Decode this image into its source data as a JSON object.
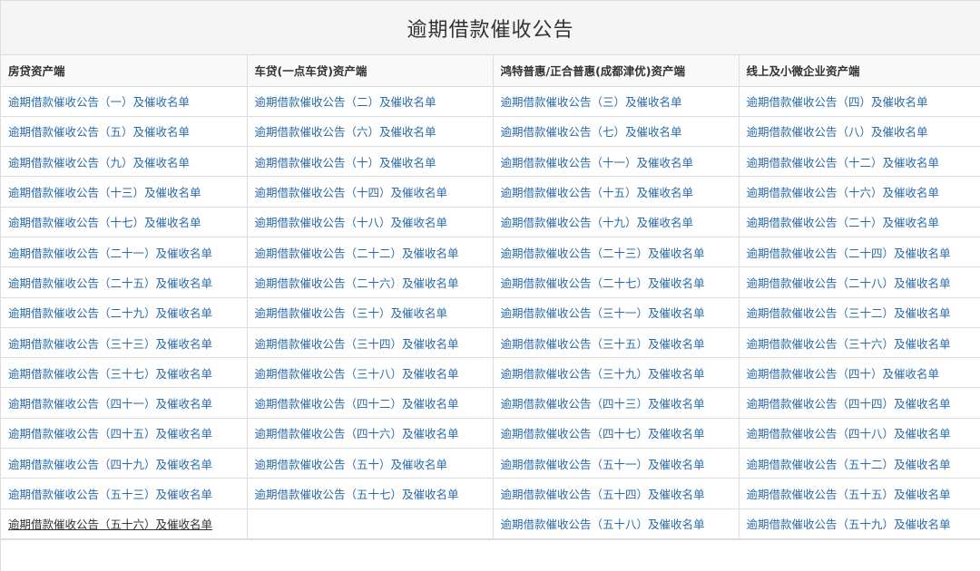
{
  "page": {
    "title": "逾期借款催收公告"
  },
  "table": {
    "headers": [
      "房贷资产端",
      "车贷(一点车贷)资产端",
      "鸿特普惠/正合普惠(成都津优)资产端",
      "线上及小微企业资产端"
    ],
    "rows": [
      [
        "逾期借款催收公告（一）及催收名单",
        "逾期借款催收公告（二）及催收名单",
        "逾期借款催收公告（三）及催收名单",
        "逾期借款催收公告（四）及催收名单"
      ],
      [
        "逾期借款催收公告（五）及催收名单",
        "逾期借款催收公告（六）及催收名单",
        "逾期借款催收公告（七）及催收名单",
        "逾期借款催收公告（八）及催收名单"
      ],
      [
        "逾期借款催收公告（九）及催收名单",
        "逾期借款催收公告（十）及催收名单",
        "逾期借款催收公告（十一）及催收名单",
        "逾期借款催收公告（十二）及催收名单"
      ],
      [
        "逾期借款催收公告（十三）及催收名单",
        "逾期借款催收公告（十四）及催收名单",
        "逾期借款催收公告（十五）及催收名单",
        "逾期借款催收公告（十六）及催收名单"
      ],
      [
        "逾期借款催收公告（十七）及催收名单",
        "逾期借款催收公告（十八）及催收名单",
        "逾期借款催收公告（十九）及催收名单",
        "逾期借款催收公告（二十）及催收名单"
      ],
      [
        "逾期借款催收公告（二十一）及催收名单",
        "逾期借款催收公告（二十二）及催收名单",
        "逾期借款催收公告（二十三）及催收名单",
        "逾期借款催收公告（二十四）及催收名单"
      ],
      [
        "逾期借款催收公告（二十五）及催收名单",
        "逾期借款催收公告（二十六）及催收名单",
        "逾期借款催收公告（二十七）及催收名单",
        "逾期借款催收公告（二十八）及催收名单"
      ],
      [
        "逾期借款催收公告（二十九）及催收名单",
        "逾期借款催收公告（三十）及催收名单",
        "逾期借款催收公告（三十一）及催收名单",
        "逾期借款催收公告（三十二）及催收名单"
      ],
      [
        "逾期借款催收公告（三十三）及催收名单",
        "逾期借款催收公告（三十四）及催收名单",
        "逾期借款催收公告（三十五）及催收名单",
        "逾期借款催收公告（三十六）及催收名单"
      ],
      [
        "逾期借款催收公告（三十七）及催收名单",
        "逾期借款催收公告（三十八）及催收名单",
        "逾期借款催收公告（三十九）及催收名单",
        "逾期借款催收公告（四十）及催收名单"
      ],
      [
        "逾期借款催收公告（四十一）及催收名单",
        "逾期借款催收公告（四十二）及催收名单",
        "逾期借款催收公告（四十三）及催收名单",
        "逾期借款催收公告（四十四）及催收名单"
      ],
      [
        "逾期借款催收公告（四十五）及催收名单",
        "逾期借款催收公告（四十六）及催收名单",
        "逾期借款催收公告（四十七）及催收名单",
        "逾期借款催收公告（四十八）及催收名单"
      ],
      [
        "逾期借款催收公告（四十九）及催收名单",
        "逾期借款催收公告（五十）及催收名单",
        "逾期借款催收公告（五十一）及催收名单",
        "逾期借款催收公告（五十二）及催收名单"
      ],
      [
        "逾期借款催收公告（五十三）及催收名单",
        "逾期借款催收公告（五十七）及催收名单",
        "逾期借款催收公告（五十四）及催收名单",
        "逾期借款催收公告（五十五）及催收名单"
      ],
      [
        "逾期借款催收公告（五十六）及催收名单",
        "",
        "逾期借款催收公告（五十八）及催收名单",
        "逾期借款催收公告（五十九）及催收名单"
      ]
    ]
  },
  "colors": {
    "link": "#2a6ba8",
    "border": "#dddddd",
    "title_bg": "#f5f5f5"
  }
}
